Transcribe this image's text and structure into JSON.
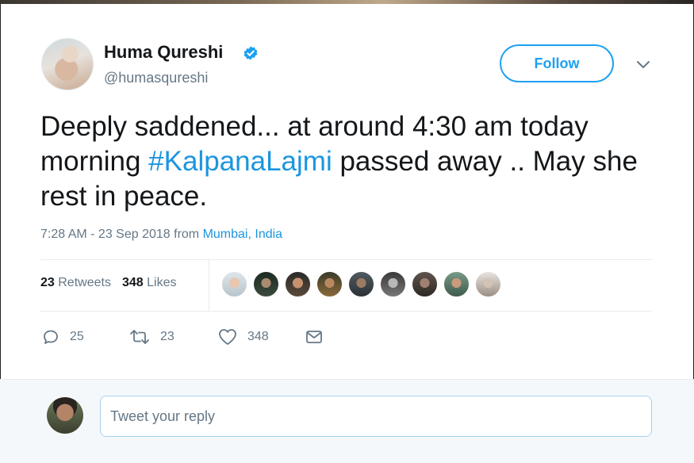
{
  "user": {
    "name": "Huma Qureshi",
    "handle": "@humasqureshi",
    "verified": true
  },
  "follow_label": "Follow",
  "tweet": {
    "text_before": "Deeply saddened... at around 4:30 am today morning ",
    "hashtag": "#KalpanaLajmi",
    "text_after": " passed away .. May she rest in peace.",
    "time": "7:28 AM - 23 Sep 2018",
    "from_label": "from",
    "location": "Mumbai, India"
  },
  "stats": {
    "retweets_count": "23",
    "retweets_label": "Retweets",
    "likes_count": "348",
    "likes_label": "Likes"
  },
  "actions": {
    "reply_count": "25",
    "retweet_count": "23",
    "like_count": "348"
  },
  "reply": {
    "placeholder": "Tweet your reply"
  },
  "colors": {
    "accent": "#1da1f2",
    "link": "#1b95e0",
    "muted": "#657786",
    "text": "#14171a"
  },
  "liker_avatars": [
    "liker-avatar",
    "liker-avatar",
    "liker-avatar",
    "liker-avatar",
    "liker-avatar",
    "liker-avatar",
    "liker-avatar",
    "liker-avatar",
    "liker-avatar"
  ]
}
